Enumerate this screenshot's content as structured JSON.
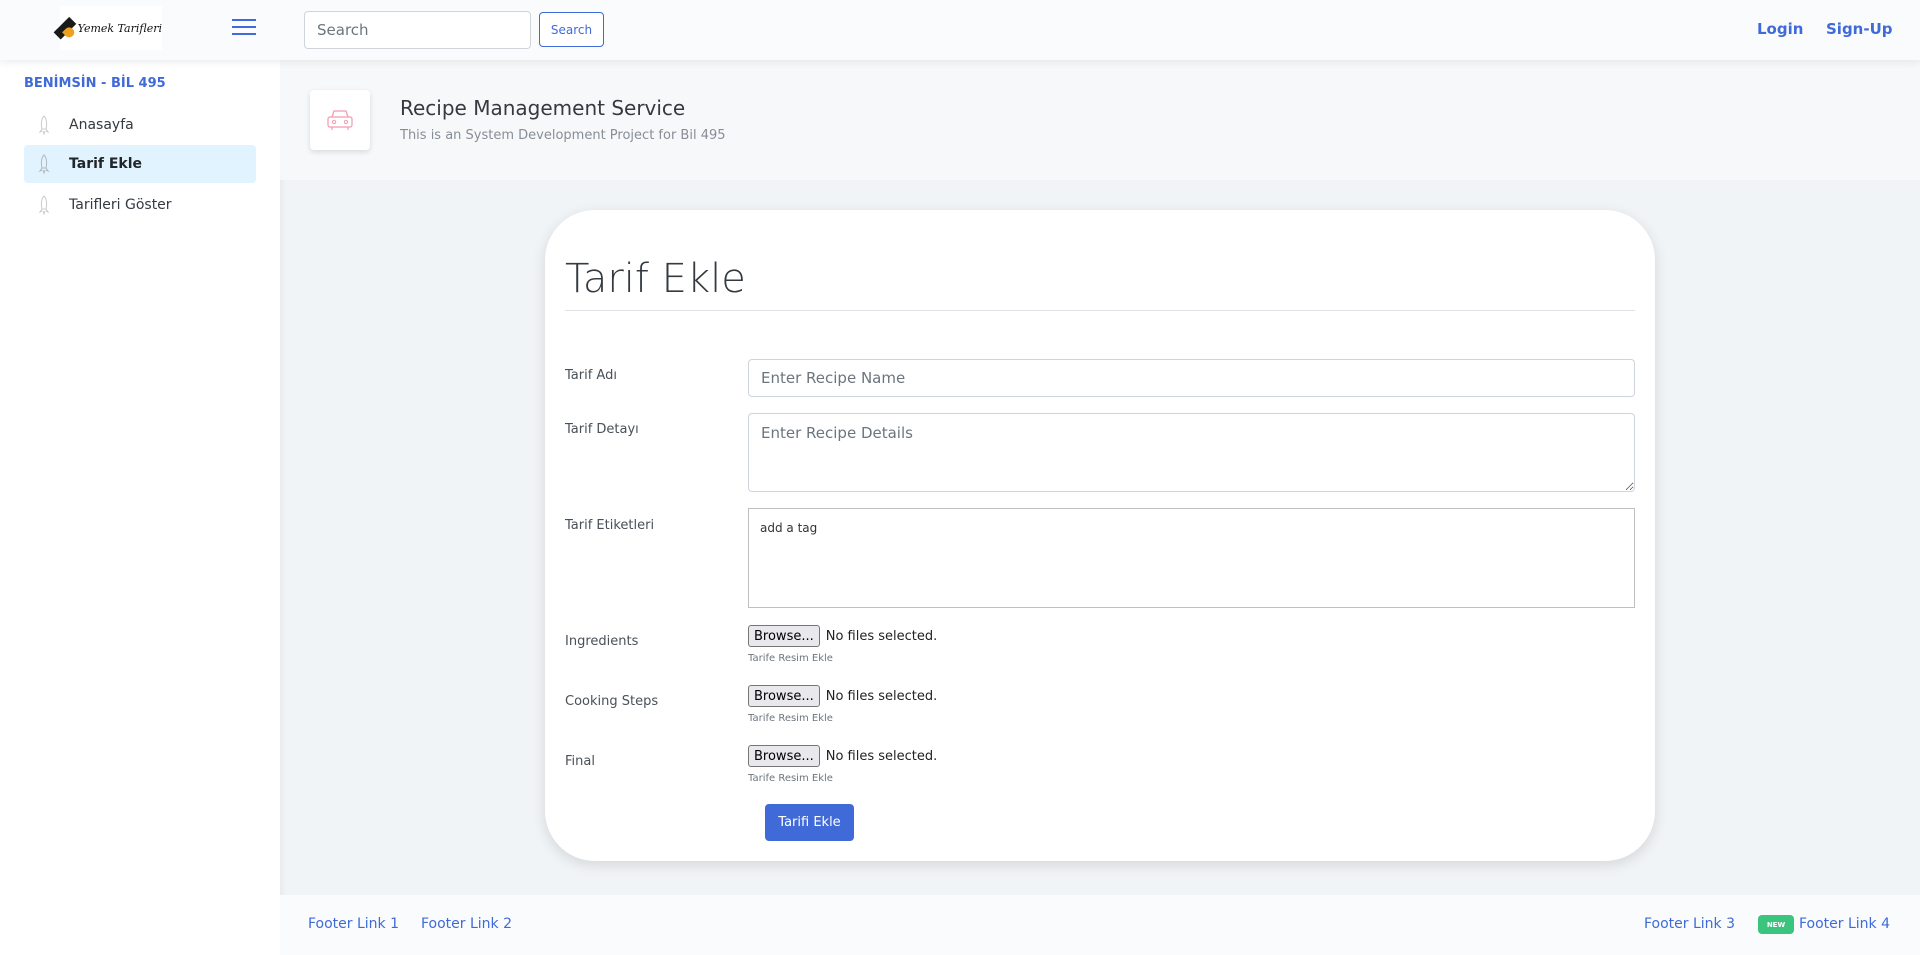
{
  "header": {
    "logo_text": "Yemek Tarifleri",
    "search_placeholder": "Search",
    "search_button": "Search",
    "login": "Login",
    "signup": "Sign-Up"
  },
  "sidebar": {
    "heading": "BENİMSİN - BİL 495",
    "items": [
      {
        "label": "Anasayfa",
        "active": false
      },
      {
        "label": "Tarif Ekle",
        "active": true
      },
      {
        "label": "Tarifleri Göster",
        "active": false
      }
    ]
  },
  "page_title": {
    "heading": "Recipe Management Service",
    "subheading": "This is an System Development Project for Bil 495"
  },
  "form": {
    "title": "Tarif Ekle",
    "name_label": "Tarif Adı",
    "name_placeholder": "Enter Recipe Name",
    "details_label": "Tarif Detayı",
    "details_placeholder": "Enter Recipe Details",
    "tags_label": "Tarif Etiketleri",
    "tags_placeholder": "add a tag",
    "files": [
      {
        "label": "Ingredients",
        "button": "Browse...",
        "status": "No files selected.",
        "help": "Tarife Resim Ekle"
      },
      {
        "label": "Cooking Steps",
        "button": "Browse...",
        "status": "No files selected.",
        "help": "Tarife Resim Ekle"
      },
      {
        "label": "Final",
        "button": "Browse...",
        "status": "No files selected.",
        "help": "Tarife Resim Ekle"
      }
    ],
    "submit": "Tarifi Ekle"
  },
  "footer": {
    "links": [
      "Footer Link 1",
      "Footer Link 2",
      "Footer Link 3",
      "Footer Link 4"
    ],
    "badge": "NEW"
  },
  "colors": {
    "primary": "#3f6ad8",
    "active_item_bg": "#e0f3ff",
    "badge_green": "#3ac47d",
    "page_bg": "#f1f4f6"
  }
}
